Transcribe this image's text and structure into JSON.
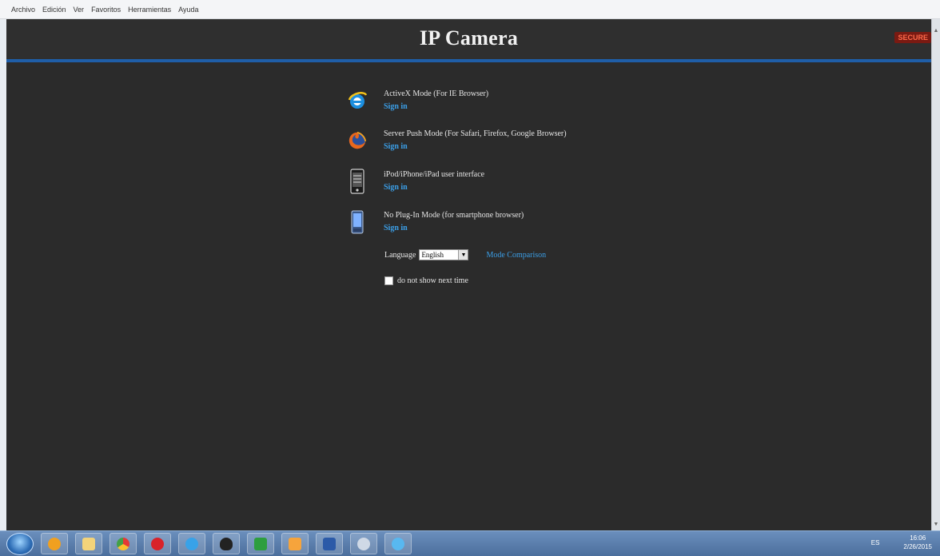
{
  "menubar": {
    "items": [
      "Archivo",
      "Edición",
      "Ver",
      "Favoritos",
      "Herramientas",
      "Ayuda"
    ]
  },
  "page": {
    "title": "IP Camera",
    "logo_text": "SECURE"
  },
  "modes": [
    {
      "name": "ActiveX Mode (For IE Browser)",
      "link": "Sign in",
      "icon": "internet-explorer-icon"
    },
    {
      "name": "Server Push Mode (For Safari, Firefox, Google Browser)",
      "link": "Sign in",
      "icon": "firefox-icon"
    },
    {
      "name": "iPod/iPhone/iPad user interface",
      "link": "Sign in",
      "icon": "phone-device-icon"
    },
    {
      "name": "No Plug-In Mode (for smartphone browser)",
      "link": "Sign in",
      "icon": "smartphone-icon"
    }
  ],
  "language": {
    "label": "Language",
    "selected": "English",
    "comparison_link": "Mode Comparison"
  },
  "remember": {
    "label": "do not show next time",
    "checked": false
  },
  "taskbar": {
    "apps": [
      "explorer",
      "media-player",
      "folder",
      "chrome",
      "opera",
      "internet-explorer",
      "qq",
      "spreadsheet",
      "office",
      "word",
      "search",
      "network"
    ],
    "tray_lang": "ES",
    "time": "16:06",
    "date": "2/26/2015"
  },
  "colors": {
    "background": "#2b2b2b",
    "header_border": "#1f5ea8",
    "link": "#3b9fe8"
  }
}
